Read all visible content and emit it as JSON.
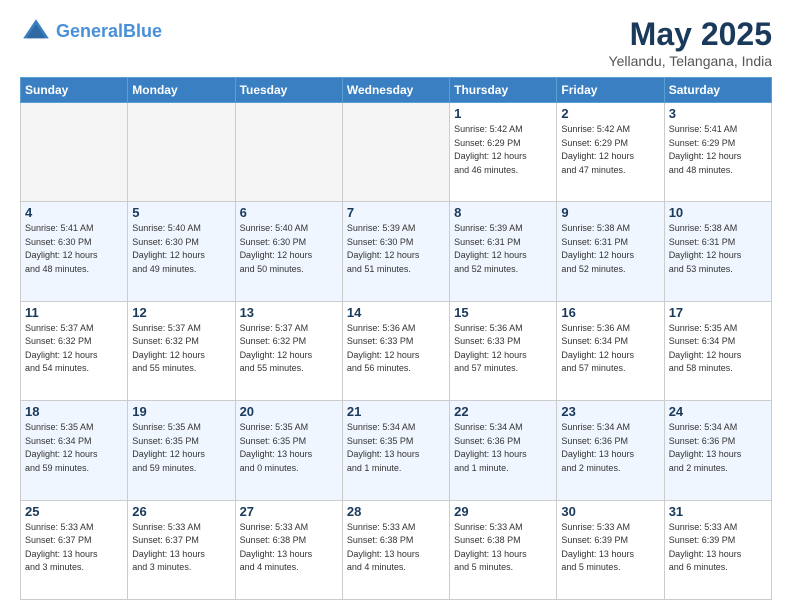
{
  "header": {
    "logo_line1": "General",
    "logo_line2": "Blue",
    "month": "May 2025",
    "location": "Yellandu, Telangana, India"
  },
  "weekdays": [
    "Sunday",
    "Monday",
    "Tuesday",
    "Wednesday",
    "Thursday",
    "Friday",
    "Saturday"
  ],
  "weeks": [
    [
      {
        "day": "",
        "info": ""
      },
      {
        "day": "",
        "info": ""
      },
      {
        "day": "",
        "info": ""
      },
      {
        "day": "",
        "info": ""
      },
      {
        "day": "1",
        "info": "Sunrise: 5:42 AM\nSunset: 6:29 PM\nDaylight: 12 hours\nand 46 minutes."
      },
      {
        "day": "2",
        "info": "Sunrise: 5:42 AM\nSunset: 6:29 PM\nDaylight: 12 hours\nand 47 minutes."
      },
      {
        "day": "3",
        "info": "Sunrise: 5:41 AM\nSunset: 6:29 PM\nDaylight: 12 hours\nand 48 minutes."
      }
    ],
    [
      {
        "day": "4",
        "info": "Sunrise: 5:41 AM\nSunset: 6:30 PM\nDaylight: 12 hours\nand 48 minutes."
      },
      {
        "day": "5",
        "info": "Sunrise: 5:40 AM\nSunset: 6:30 PM\nDaylight: 12 hours\nand 49 minutes."
      },
      {
        "day": "6",
        "info": "Sunrise: 5:40 AM\nSunset: 6:30 PM\nDaylight: 12 hours\nand 50 minutes."
      },
      {
        "day": "7",
        "info": "Sunrise: 5:39 AM\nSunset: 6:30 PM\nDaylight: 12 hours\nand 51 minutes."
      },
      {
        "day": "8",
        "info": "Sunrise: 5:39 AM\nSunset: 6:31 PM\nDaylight: 12 hours\nand 52 minutes."
      },
      {
        "day": "9",
        "info": "Sunrise: 5:38 AM\nSunset: 6:31 PM\nDaylight: 12 hours\nand 52 minutes."
      },
      {
        "day": "10",
        "info": "Sunrise: 5:38 AM\nSunset: 6:31 PM\nDaylight: 12 hours\nand 53 minutes."
      }
    ],
    [
      {
        "day": "11",
        "info": "Sunrise: 5:37 AM\nSunset: 6:32 PM\nDaylight: 12 hours\nand 54 minutes."
      },
      {
        "day": "12",
        "info": "Sunrise: 5:37 AM\nSunset: 6:32 PM\nDaylight: 12 hours\nand 55 minutes."
      },
      {
        "day": "13",
        "info": "Sunrise: 5:37 AM\nSunset: 6:32 PM\nDaylight: 12 hours\nand 55 minutes."
      },
      {
        "day": "14",
        "info": "Sunrise: 5:36 AM\nSunset: 6:33 PM\nDaylight: 12 hours\nand 56 minutes."
      },
      {
        "day": "15",
        "info": "Sunrise: 5:36 AM\nSunset: 6:33 PM\nDaylight: 12 hours\nand 57 minutes."
      },
      {
        "day": "16",
        "info": "Sunrise: 5:36 AM\nSunset: 6:34 PM\nDaylight: 12 hours\nand 57 minutes."
      },
      {
        "day": "17",
        "info": "Sunrise: 5:35 AM\nSunset: 6:34 PM\nDaylight: 12 hours\nand 58 minutes."
      }
    ],
    [
      {
        "day": "18",
        "info": "Sunrise: 5:35 AM\nSunset: 6:34 PM\nDaylight: 12 hours\nand 59 minutes."
      },
      {
        "day": "19",
        "info": "Sunrise: 5:35 AM\nSunset: 6:35 PM\nDaylight: 12 hours\nand 59 minutes."
      },
      {
        "day": "20",
        "info": "Sunrise: 5:35 AM\nSunset: 6:35 PM\nDaylight: 13 hours\nand 0 minutes."
      },
      {
        "day": "21",
        "info": "Sunrise: 5:34 AM\nSunset: 6:35 PM\nDaylight: 13 hours\nand 1 minute."
      },
      {
        "day": "22",
        "info": "Sunrise: 5:34 AM\nSunset: 6:36 PM\nDaylight: 13 hours\nand 1 minute."
      },
      {
        "day": "23",
        "info": "Sunrise: 5:34 AM\nSunset: 6:36 PM\nDaylight: 13 hours\nand 2 minutes."
      },
      {
        "day": "24",
        "info": "Sunrise: 5:34 AM\nSunset: 6:36 PM\nDaylight: 13 hours\nand 2 minutes."
      }
    ],
    [
      {
        "day": "25",
        "info": "Sunrise: 5:33 AM\nSunset: 6:37 PM\nDaylight: 13 hours\nand 3 minutes."
      },
      {
        "day": "26",
        "info": "Sunrise: 5:33 AM\nSunset: 6:37 PM\nDaylight: 13 hours\nand 3 minutes."
      },
      {
        "day": "27",
        "info": "Sunrise: 5:33 AM\nSunset: 6:38 PM\nDaylight: 13 hours\nand 4 minutes."
      },
      {
        "day": "28",
        "info": "Sunrise: 5:33 AM\nSunset: 6:38 PM\nDaylight: 13 hours\nand 4 minutes."
      },
      {
        "day": "29",
        "info": "Sunrise: 5:33 AM\nSunset: 6:38 PM\nDaylight: 13 hours\nand 5 minutes."
      },
      {
        "day": "30",
        "info": "Sunrise: 5:33 AM\nSunset: 6:39 PM\nDaylight: 13 hours\nand 5 minutes."
      },
      {
        "day": "31",
        "info": "Sunrise: 5:33 AM\nSunset: 6:39 PM\nDaylight: 13 hours\nand 6 minutes."
      }
    ]
  ]
}
